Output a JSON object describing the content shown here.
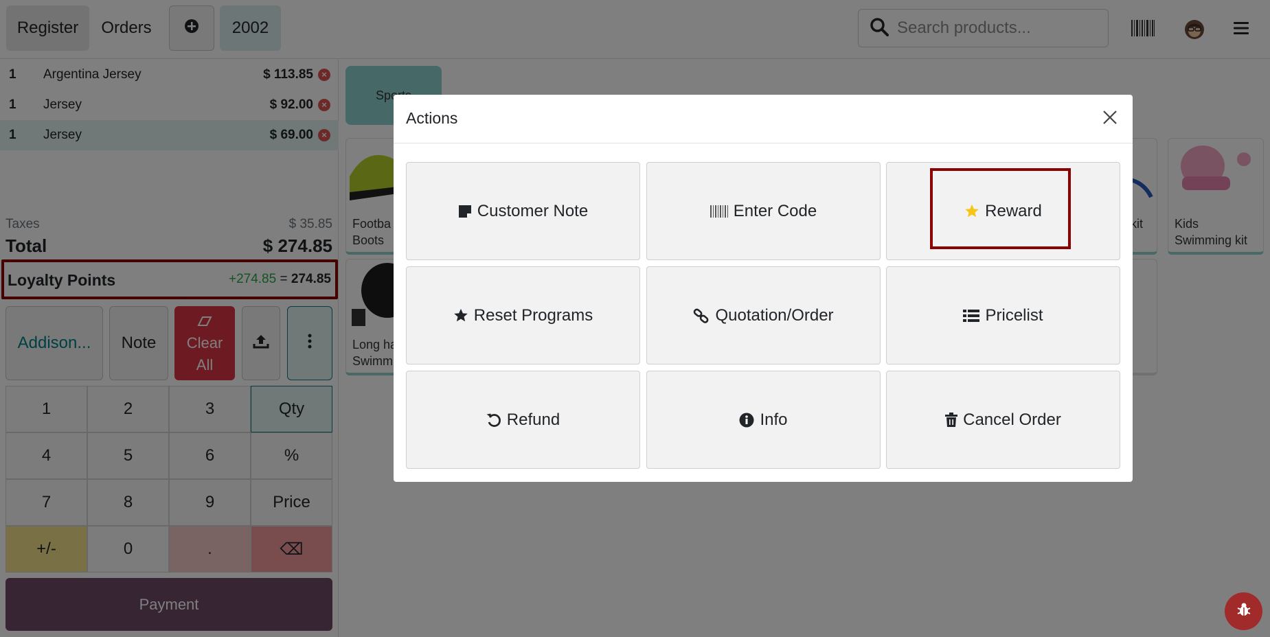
{
  "topbar": {
    "register_label": "Register",
    "orders_label": "Orders",
    "order_number": "2002",
    "search_placeholder": "Search products..."
  },
  "order_lines": [
    {
      "qty": "1",
      "name": "Argentina Jersey",
      "price": "$ 113.85"
    },
    {
      "qty": "1",
      "name": "Jersey",
      "price": "$ 92.00"
    },
    {
      "qty": "1",
      "name": "Jersey",
      "price": "$ 69.00"
    }
  ],
  "summary": {
    "taxes_label": "Taxes",
    "taxes_value": "$ 35.85",
    "total_label": "Total",
    "total_value": "$ 274.85"
  },
  "loyalty": {
    "label": "Loyalty Points",
    "added": "+274.85",
    "equals": "=",
    "total": "274.85"
  },
  "controls": {
    "customer": "Addison...",
    "note": "Note",
    "clear_line1": "Clear",
    "clear_line2": "All"
  },
  "numpad": {
    "keys": [
      "1",
      "2",
      "3",
      "Qty",
      "4",
      "5",
      "6",
      "%",
      "7",
      "8",
      "9",
      "Price",
      "+/-",
      "0",
      ".",
      "⌫"
    ]
  },
  "payment_label": "Payment",
  "products": {
    "category": "Sports",
    "items": [
      {
        "name_line1": "Footba",
        "name_line2": "Boots"
      },
      {
        "name_line1": "Long ha",
        "name_line2": "Swimm"
      },
      {
        "name_line1": "kit",
        "name_line2": ""
      },
      {
        "name_line1": "Kids",
        "name_line2": "Swimming kit"
      }
    ]
  },
  "modal": {
    "title": "Actions",
    "actions": [
      {
        "label": "Customer Note",
        "icon": "sticky-note-icon"
      },
      {
        "label": "Enter Code",
        "icon": "barcode-icon"
      },
      {
        "label": "Reward",
        "icon": "star-icon"
      },
      {
        "label": "Reset Programs",
        "icon": "star-icon"
      },
      {
        "label": "Quotation/Order",
        "icon": "link-icon"
      },
      {
        "label": "Pricelist",
        "icon": "list-icon"
      },
      {
        "label": "Refund",
        "icon": "undo-icon"
      },
      {
        "label": "Info",
        "icon": "info-icon"
      },
      {
        "label": "Cancel Order",
        "icon": "trash-icon"
      }
    ]
  },
  "colors": {
    "accent_teal": "#017e84",
    "payment_purple": "#714b67",
    "clear_red": "#dc3545",
    "highlight_red": "#8b0000",
    "star_yellow": "#f5c518"
  }
}
